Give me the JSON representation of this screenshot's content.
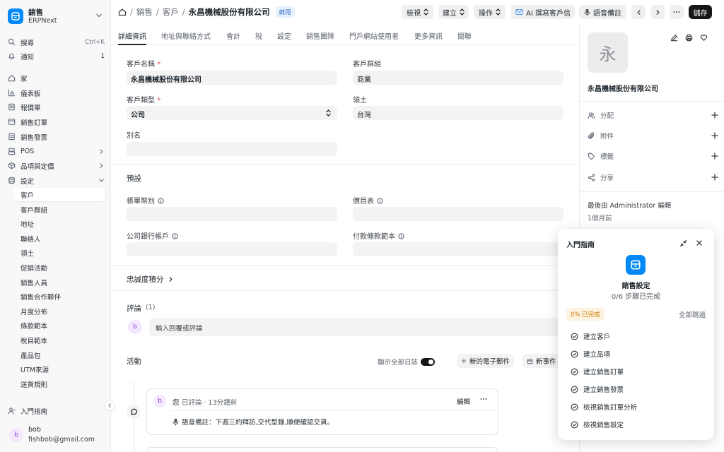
{
  "brand": {
    "title": "銷售",
    "subtitle": "ERPNext"
  },
  "sidebar": {
    "search_label": "搜尋",
    "search_shortcut": "Ctrl+K",
    "notif_label": "通知",
    "notif_count": "1",
    "items": [
      {
        "label": "家",
        "icon": "home-icon"
      },
      {
        "label": "儀表板",
        "icon": "chart-icon"
      },
      {
        "label": "報價單",
        "icon": "file-icon"
      },
      {
        "label": "銷售訂單",
        "icon": "tablet-icon"
      },
      {
        "label": "銷售發票",
        "icon": "file-icon"
      },
      {
        "label": "POS",
        "icon": "pos-icon"
      },
      {
        "label": "品項與定價",
        "icon": "box-icon"
      },
      {
        "label": "設定",
        "icon": "database-icon"
      }
    ],
    "sub_items": [
      "客戶",
      "客戶群組",
      "地址",
      "聯絡人",
      "領土",
      "促銷活動",
      "銷售人員",
      "銷售合作夥伴",
      "月度分佈",
      "條款範本",
      "稅目範本",
      "產品包",
      "UTM來源",
      "送貨規則"
    ],
    "guide_label": "入門指南",
    "user_initial": "b",
    "user_name": "bob",
    "user_email": "fishbob@gmail.com"
  },
  "header": {
    "crumb1": "銷售",
    "crumb2": "客戶",
    "title": "永昌機械股份有限公司",
    "status": "啟用",
    "btn_view": "檢視",
    "btn_create": "建立",
    "btn_actions": "操作",
    "btn_ai": "AI 撰寫客戶信",
    "btn_voice": "語音備註",
    "btn_save": "儲存"
  },
  "tabs": [
    "詳細資訊",
    "地址與聯絡方式",
    "會計",
    "稅",
    "設定",
    "銷售團隊",
    "門戶網站使用者",
    "更多資訊",
    "關聯"
  ],
  "form": {
    "customer_name_label": "客戶名稱",
    "customer_name": "永昌機械股份有限公司",
    "customer_group_label": "客戶群組",
    "customer_group": "商業",
    "customer_type_label": "客戶類型",
    "customer_type": "公司",
    "territory_label": "領土",
    "territory": "台灣",
    "alias_label": "別名",
    "defaults_title": "預設",
    "currency_label": "帳單幣別",
    "price_list_label": "價目表",
    "bank_label": "公司銀行帳戶",
    "terms_label": "付款條款範本",
    "loyalty_label": "忠誠度積分",
    "comments_label": "評論",
    "comments_count": "(1)",
    "comment_avatar": "b",
    "comment_placeholder": "輸入回覆或評論",
    "activity_label": "活動",
    "show_all_logs": "顯示全部日誌",
    "new_email": "新的電子郵件",
    "new_event": "新事件",
    "comment_author": "您",
    "comment_meta": "已評論 · 13分鐘前",
    "comment_edit": "編輯",
    "comment_text": "語音備註：下週三約拜訪,交代型錄,順便確認交貨。"
  },
  "right_panel": {
    "avatar_char": "永",
    "name": "永昌機械股份有限公司",
    "assign": "分配",
    "attach": "附件",
    "tags": "標籤",
    "share": "分享",
    "edited_by": "最後由 Administrator 編輯",
    "edited_when": "1個月前"
  },
  "onboarding": {
    "title": "入門指南",
    "module_name": "銷售設定",
    "progress_text": "0/6 步驟已完成",
    "percent": "0% 已完成",
    "progress_fraction": 0,
    "skip_all": "全部跳過",
    "steps": [
      "建立客戶",
      "建立品項",
      "建立銷售訂單",
      "建立銷售發票",
      "檢視銷售訂單分析",
      "檢視銷售設定"
    ]
  }
}
